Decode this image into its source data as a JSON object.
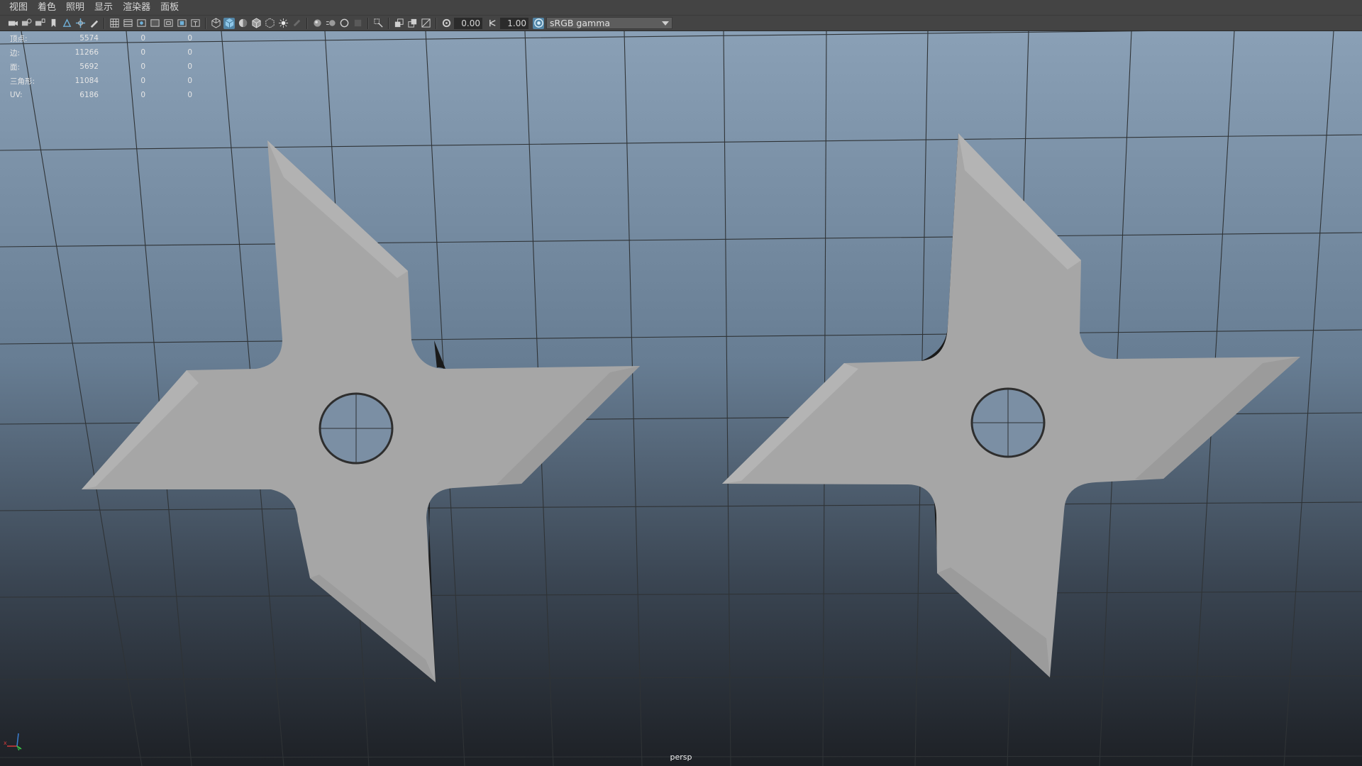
{
  "menu": [
    "视图",
    "着色",
    "照明",
    "显示",
    "渲染器",
    "面板"
  ],
  "toolbar": {
    "exposure": "0.00",
    "gamma": "1.00",
    "color_management": "sRGB gamma",
    "icons": [
      "camera-select-icon",
      "camera-attributes-icon",
      "bookmark-icon",
      "image-plane-icon",
      "grease-pencil-icon",
      "2d-pan-zoom-icon",
      "grid-icon",
      "film-gate-icon",
      "resolution-gate-icon",
      "gate-mask-icon",
      "field-chart-icon",
      "safe-action-icon",
      "safe-title-icon",
      "wireframe-icon",
      "smooth-shade-icon",
      "default-material-icon",
      "wireframe-on-shaded-icon",
      "xray-icon",
      "use-all-lights-icon",
      "shadows-icon",
      "screen-space-ao-icon",
      "motion-blur-icon",
      "multisample-aa-icon",
      "depth-of-field-icon",
      "isolate-select-icon",
      "xray-joints-icon",
      "xray-active-icon",
      "backface-culling-icon",
      "exposure-icon",
      "gamma-icon",
      "color-management-icon"
    ]
  },
  "hud": {
    "rows": [
      {
        "label": "顶点:",
        "v1": "5574",
        "v2": "0",
        "v3": "0"
      },
      {
        "label": "边:",
        "v1": "11266",
        "v2": "0",
        "v3": "0"
      },
      {
        "label": "面:",
        "v1": "5692",
        "v2": "0",
        "v3": "0"
      },
      {
        "label": "三角形:",
        "v1": "11084",
        "v2": "0",
        "v3": "0"
      },
      {
        "label": "UV:",
        "v1": "6186",
        "v2": "0",
        "v3": "0"
      }
    ]
  },
  "camera": "persp",
  "axis": {
    "x": "x",
    "y": "y"
  },
  "colors": {
    "menu_bg": "#444444",
    "viewport_top": "#8398ae",
    "viewport_bottom": "#1e2126",
    "model_fill": "#a8a8a8",
    "active_accent": "#5285a6"
  }
}
